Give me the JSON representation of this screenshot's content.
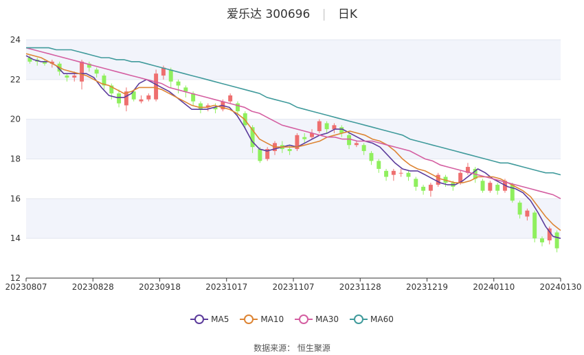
{
  "header": {
    "name": "爱乐达",
    "code": "300696",
    "period": "日K"
  },
  "footer": {
    "source_label": "数据来源：",
    "source_name": "恒生聚源"
  },
  "chart_data": {
    "type": "line",
    "subtype": "candlestick-with-moving-averages",
    "ylim": [
      12,
      24
    ],
    "yticks": [
      12,
      14,
      16,
      18,
      20,
      22,
      24
    ],
    "x_tick_labels": [
      "20230807",
      "20230828",
      "20230918",
      "20231017",
      "20231107",
      "20231128",
      "20231219",
      "20240110",
      "20240130"
    ],
    "grid": true,
    "legend_position": "bottom",
    "colors": {
      "up": "#ee6f6f",
      "down": "#8fef5e",
      "band": "#f2f4fb"
    },
    "series": [
      {
        "name": "MA5",
        "color": "#5b3b9b",
        "values": [
          23.2,
          23.0,
          22.9,
          22.9,
          22.7,
          22.3,
          22.3,
          22.3,
          22.3,
          22.1,
          21.6,
          21.2,
          21.1,
          21.1,
          21.3,
          21.8,
          22.0,
          21.8,
          21.6,
          21.4,
          21.1,
          20.8,
          20.5,
          20.5,
          20.5,
          20.6,
          20.7,
          20.6,
          20.2,
          19.6,
          18.9,
          18.5,
          18.4,
          18.5,
          18.6,
          18.7,
          18.6,
          18.8,
          19.0,
          19.2,
          19.3,
          19.5,
          19.5,
          19.3,
          19.1,
          18.9,
          18.8,
          18.6,
          18.2,
          17.8,
          17.5,
          17.4,
          17.4,
          17.2,
          17.0,
          16.8,
          16.7,
          16.7,
          16.9,
          17.2,
          17.5,
          17.3,
          17.0,
          16.8,
          16.6,
          16.5,
          16.3,
          15.9,
          15.3,
          14.6,
          14.1,
          14.0
        ]
      },
      {
        "name": "MA10",
        "color": "#dd8433",
        "values": [
          23.3,
          23.2,
          23.1,
          22.9,
          22.7,
          22.5,
          22.4,
          22.3,
          22.2,
          22.0,
          21.8,
          21.7,
          21.5,
          21.3,
          21.4,
          21.6,
          21.6,
          21.6,
          21.5,
          21.3,
          21.1,
          20.9,
          20.7,
          20.6,
          20.6,
          20.7,
          20.6,
          20.5,
          20.3,
          20.0,
          19.5,
          19.0,
          18.8,
          18.6,
          18.6,
          18.6,
          18.6,
          18.7,
          18.8,
          18.9,
          19.1,
          19.2,
          19.3,
          19.4,
          19.3,
          19.2,
          19.0,
          18.9,
          18.7,
          18.4,
          18.0,
          17.7,
          17.5,
          17.4,
          17.2,
          17.0,
          16.9,
          16.8,
          16.8,
          16.9,
          17.1,
          17.1,
          17.1,
          17.0,
          16.8,
          16.6,
          16.4,
          16.1,
          15.6,
          15.1,
          14.7,
          14.4
        ]
      },
      {
        "name": "MA30",
        "color": "#d45ea1",
        "values": [
          23.6,
          23.5,
          23.4,
          23.3,
          23.2,
          23.1,
          23.0,
          22.9,
          22.8,
          22.7,
          22.6,
          22.5,
          22.4,
          22.3,
          22.2,
          22.1,
          22.0,
          21.9,
          21.8,
          21.6,
          21.5,
          21.4,
          21.3,
          21.2,
          21.1,
          21.0,
          20.9,
          20.8,
          20.7,
          20.6,
          20.4,
          20.3,
          20.1,
          19.9,
          19.7,
          19.6,
          19.5,
          19.4,
          19.3,
          19.2,
          19.1,
          19.1,
          19.0,
          19.0,
          18.9,
          18.9,
          18.9,
          18.8,
          18.7,
          18.6,
          18.5,
          18.4,
          18.2,
          18.0,
          17.9,
          17.7,
          17.6,
          17.5,
          17.4,
          17.3,
          17.2,
          17.1,
          17.0,
          16.9,
          16.8,
          16.7,
          16.6,
          16.5,
          16.4,
          16.3,
          16.2,
          16.0
        ]
      },
      {
        "name": "MA60",
        "color": "#3f9a9b",
        "values": [
          23.6,
          23.6,
          23.6,
          23.6,
          23.5,
          23.5,
          23.5,
          23.4,
          23.3,
          23.2,
          23.1,
          23.1,
          23.0,
          23.0,
          22.9,
          22.9,
          22.8,
          22.7,
          22.6,
          22.5,
          22.4,
          22.3,
          22.2,
          22.1,
          22.0,
          21.9,
          21.8,
          21.7,
          21.6,
          21.5,
          21.4,
          21.3,
          21.1,
          21.0,
          20.9,
          20.8,
          20.6,
          20.5,
          20.4,
          20.3,
          20.2,
          20.1,
          20.0,
          19.9,
          19.8,
          19.7,
          19.6,
          19.5,
          19.4,
          19.3,
          19.2,
          19.0,
          18.9,
          18.8,
          18.7,
          18.6,
          18.5,
          18.4,
          18.3,
          18.2,
          18.1,
          18.0,
          17.9,
          17.8,
          17.8,
          17.7,
          17.6,
          17.5,
          17.4,
          17.3,
          17.3,
          17.2
        ]
      }
    ],
    "candles": [
      [
        23.1,
        22.9,
        23.2,
        22.8
      ],
      [
        23.0,
        22.9,
        23.1,
        22.7
      ],
      [
        22.9,
        22.8,
        23.0,
        22.7
      ],
      [
        22.8,
        22.9,
        23.0,
        22.6
      ],
      [
        22.8,
        22.4,
        22.9,
        22.2
      ],
      [
        22.2,
        22.1,
        22.3,
        21.9
      ],
      [
        22.1,
        22.2,
        22.4,
        21.9
      ],
      [
        21.9,
        22.9,
        23.0,
        21.5
      ],
      [
        22.8,
        22.6,
        22.9,
        22.4
      ],
      [
        22.5,
        22.3,
        22.6,
        22.1
      ],
      [
        22.2,
        21.7,
        22.3,
        21.5
      ],
      [
        21.7,
        21.3,
        21.8,
        21.0
      ],
      [
        21.3,
        20.8,
        21.5,
        20.6
      ],
      [
        20.7,
        21.4,
        21.6,
        20.4
      ],
      [
        21.4,
        21.0,
        21.5,
        20.9
      ],
      [
        20.9,
        21.0,
        21.2,
        20.8
      ],
      [
        21.0,
        21.2,
        21.3,
        20.9
      ],
      [
        21.0,
        22.3,
        22.5,
        20.9
      ],
      [
        22.2,
        22.6,
        22.7,
        22.0
      ],
      [
        22.5,
        21.9,
        22.6,
        21.6
      ],
      [
        21.9,
        21.7,
        22.0,
        21.3
      ],
      [
        21.6,
        21.4,
        21.7,
        21.1
      ],
      [
        21.3,
        20.9,
        21.4,
        20.7
      ],
      [
        20.8,
        20.5,
        20.9,
        20.3
      ],
      [
        20.6,
        20.7,
        20.8,
        20.4
      ],
      [
        20.6,
        20.5,
        20.8,
        20.3
      ],
      [
        20.5,
        20.9,
        21.0,
        20.4
      ],
      [
        20.9,
        21.2,
        21.3,
        20.8
      ],
      [
        20.8,
        20.4,
        20.9,
        20.2
      ],
      [
        20.3,
        19.7,
        20.4,
        19.5
      ],
      [
        19.6,
        18.6,
        19.7,
        18.3
      ],
      [
        18.5,
        17.9,
        18.6,
        17.8
      ],
      [
        18.0,
        18.5,
        18.6,
        17.9
      ],
      [
        18.4,
        18.8,
        18.9,
        18.2
      ],
      [
        18.7,
        18.5,
        18.9,
        18.3
      ],
      [
        18.5,
        18.4,
        18.7,
        18.2
      ],
      [
        18.5,
        19.2,
        19.3,
        18.4
      ],
      [
        19.1,
        19.0,
        19.3,
        18.8
      ],
      [
        19.1,
        19.3,
        19.5,
        19.0
      ],
      [
        19.4,
        19.9,
        20.0,
        19.3
      ],
      [
        19.8,
        19.5,
        19.9,
        19.3
      ],
      [
        19.5,
        19.7,
        19.8,
        19.3
      ],
      [
        19.6,
        19.3,
        19.7,
        19.1
      ],
      [
        19.2,
        18.7,
        19.3,
        18.5
      ],
      [
        18.7,
        18.8,
        18.9,
        18.6
      ],
      [
        18.7,
        18.4,
        18.8,
        18.2
      ],
      [
        18.3,
        17.9,
        18.4,
        17.7
      ],
      [
        17.9,
        17.5,
        18.0,
        17.3
      ],
      [
        17.4,
        17.1,
        17.5,
        16.9
      ],
      [
        17.2,
        17.4,
        17.5,
        16.9
      ],
      [
        17.3,
        17.3,
        17.5,
        17.1
      ],
      [
        17.3,
        17.1,
        17.4,
        16.9
      ],
      [
        17.0,
        16.6,
        17.1,
        16.4
      ],
      [
        16.6,
        16.4,
        16.7,
        16.2
      ],
      [
        16.4,
        16.7,
        16.8,
        16.1
      ],
      [
        16.7,
        17.2,
        17.3,
        16.6
      ],
      [
        17.1,
        16.8,
        17.2,
        16.6
      ],
      [
        16.8,
        16.6,
        16.9,
        16.4
      ],
      [
        16.8,
        17.3,
        17.4,
        16.7
      ],
      [
        17.3,
        17.6,
        17.8,
        17.2
      ],
      [
        17.5,
        17.0,
        17.6,
        16.8
      ],
      [
        16.9,
        16.4,
        17.0,
        16.3
      ],
      [
        16.4,
        16.8,
        16.9,
        16.3
      ],
      [
        16.7,
        16.4,
        16.8,
        16.2
      ],
      [
        16.4,
        16.9,
        17.0,
        16.3
      ],
      [
        16.7,
        15.9,
        16.8,
        15.8
      ],
      [
        15.8,
        15.2,
        15.9,
        15.0
      ],
      [
        15.1,
        15.4,
        15.5,
        14.9
      ],
      [
        15.3,
        14.0,
        15.4,
        13.8
      ],
      [
        14.0,
        13.8,
        14.1,
        13.6
      ],
      [
        13.9,
        14.5,
        14.6,
        13.7
      ],
      [
        14.3,
        13.5,
        14.4,
        13.3
      ]
    ]
  }
}
